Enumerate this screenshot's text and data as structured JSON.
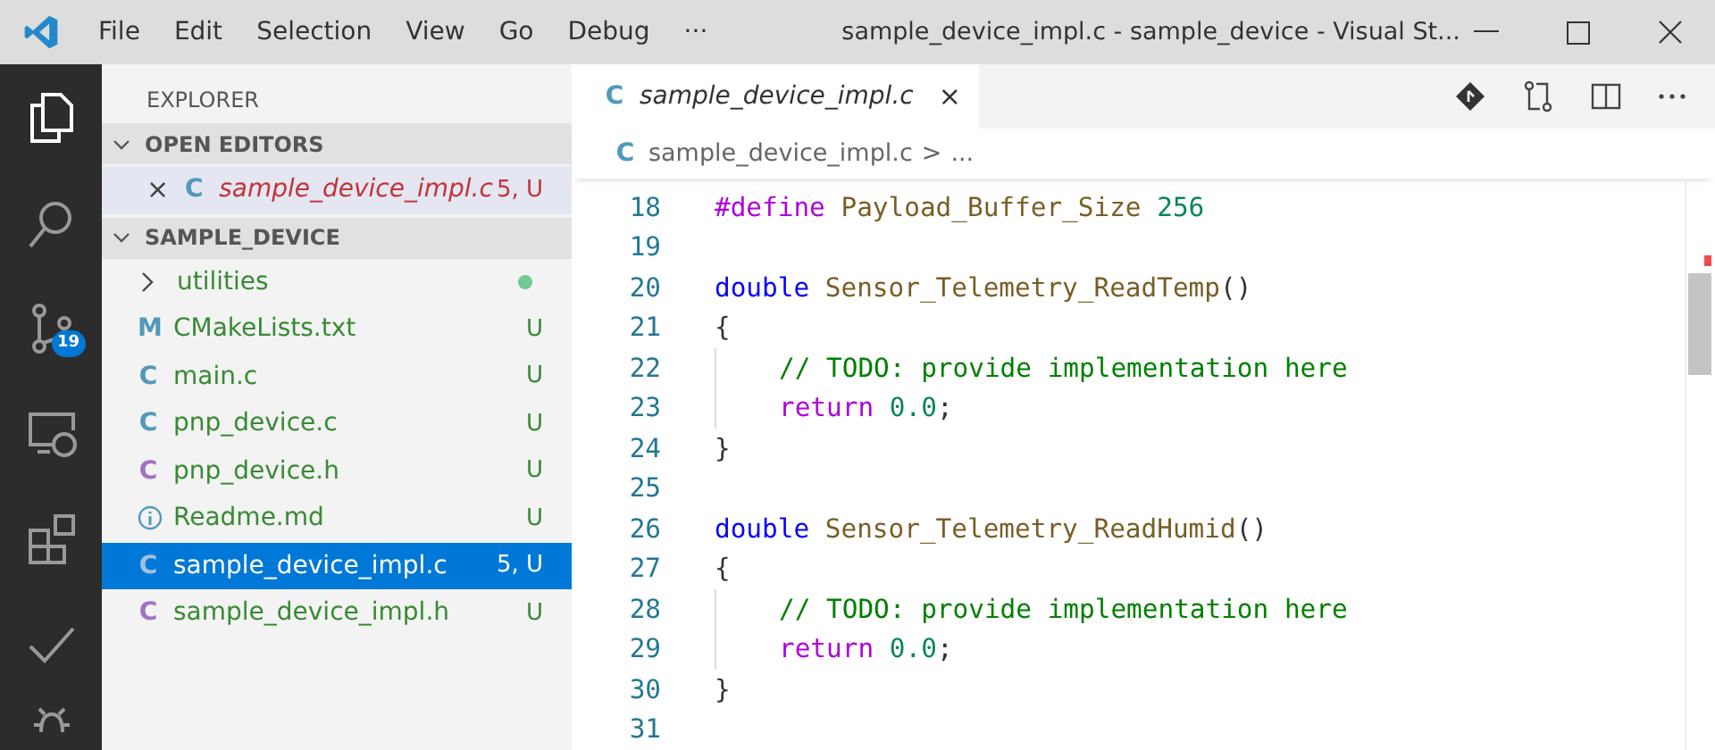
{
  "window": {
    "title": "sample_device_impl.c - sample_device - Visual St..."
  },
  "menu": [
    "File",
    "Edit",
    "Selection",
    "View",
    "Go",
    "Debug",
    "···"
  ],
  "activity_bar": [
    {
      "kind": "files",
      "selected": true
    },
    {
      "kind": "search",
      "selected": false
    },
    {
      "kind": "source-control",
      "selected": false,
      "badge": "19"
    },
    {
      "kind": "remote",
      "selected": false
    },
    {
      "kind": "extensions",
      "selected": false
    },
    {
      "kind": "check",
      "selected": false
    },
    {
      "kind": "debug",
      "selected": false
    }
  ],
  "sidebar": {
    "title": "EXPLORER",
    "open_editors": {
      "title": "OPEN EDITORS",
      "expanded": true,
      "items": [
        {
          "close": "×",
          "icon_text": "C",
          "name": "sample_device_impl.c",
          "decoration": "5, U",
          "has_errors": true,
          "selected": true
        }
      ]
    },
    "folder": {
      "title": "SAMPLE_DEVICE",
      "expanded": true,
      "items": [
        {
          "kind": "folder",
          "name": "utilities",
          "expanded": false,
          "color": "#73c991"
        },
        {
          "kind": "cmake",
          "icon_text": "M",
          "name": "CMakeLists.txt",
          "decoration": "U",
          "has_errors": false,
          "selected": false
        },
        {
          "kind": "source",
          "icon_text": "C",
          "name": "main.c",
          "decoration": "U",
          "has_errors": false,
          "selected": false
        },
        {
          "kind": "source",
          "icon_text": "C",
          "name": "pnp_device.c",
          "decoration": "U",
          "has_errors": false,
          "selected": false
        },
        {
          "kind": "header",
          "icon_text": "C",
          "name": "pnp_device.h",
          "decoration": "U",
          "has_errors": false,
          "selected": false
        },
        {
          "kind": "readme",
          "name": "Readme.md",
          "decoration": "U",
          "has_errors": false,
          "selected": false
        },
        {
          "kind": "source",
          "icon_text": "C",
          "name": "sample_device_impl.c",
          "decoration": "5, U",
          "selected": true
        },
        {
          "kind": "header",
          "icon_text": "C",
          "name": "sample_device_impl.h",
          "decoration": "U",
          "has_errors": false,
          "selected": false
        }
      ]
    }
  },
  "editor": {
    "tabs": [
      {
        "icon_text": "C",
        "label": "sample_device_impl.c",
        "close": "×",
        "selected": true
      }
    ],
    "breadcrumb": {
      "icon_text": "C",
      "file": "sample_device_impl.c",
      "separator": ">",
      "rest": "..."
    },
    "lines": [
      {
        "number": "18",
        "kind": "top",
        "tokens": [
          {
            "kind": "directive",
            "text": "#define"
          },
          {
            "kind": "type",
            "text": " Payload_Buffer_Size "
          },
          {
            "kind": "number",
            "text": "256"
          }
        ]
      },
      {
        "number": "19",
        "kind": "top"
      },
      {
        "number": "20",
        "kind": "top",
        "tokens": [
          {
            "kind": "keyword",
            "text": "double"
          },
          {
            "kind": "function",
            "text": " Sensor_Telemetry_ReadTemp"
          },
          {
            "kind": "plain",
            "text": "()"
          }
        ]
      },
      {
        "number": "21",
        "kind": "top",
        "tokens": [
          {
            "kind": "plain",
            "text": "{"
          }
        ]
      },
      {
        "number": "22",
        "kind": "body",
        "tokens": [
          {
            "kind": "comment",
            "text": "// TODO: provide implementation here"
          }
        ]
      },
      {
        "number": "23",
        "kind": "body",
        "tokens": [
          {
            "kind": "control",
            "text": "return"
          },
          {
            "kind": "number",
            "text": " 0.0"
          },
          {
            "kind": "plain",
            "text": ";"
          }
        ]
      },
      {
        "number": "24",
        "kind": "top",
        "tokens": [
          {
            "kind": "plain",
            "text": "}"
          }
        ]
      },
      {
        "number": "25",
        "kind": "top"
      },
      {
        "number": "26",
        "kind": "top",
        "tokens": [
          {
            "kind": "keyword",
            "text": "double"
          },
          {
            "kind": "function",
            "text": " Sensor_Telemetry_ReadHumid"
          },
          {
            "kind": "plain",
            "text": "()"
          }
        ]
      },
      {
        "number": "27",
        "kind": "top",
        "tokens": [
          {
            "kind": "plain",
            "text": "{"
          }
        ]
      },
      {
        "number": "28",
        "kind": "body",
        "tokens": [
          {
            "kind": "comment",
            "text": "// TODO: provide implementation here"
          }
        ]
      },
      {
        "number": "29",
        "kind": "body",
        "tokens": [
          {
            "kind": "control",
            "text": "return"
          },
          {
            "kind": "number",
            "text": " 0.0"
          },
          {
            "kind": "plain",
            "text": ";"
          }
        ]
      },
      {
        "number": "30",
        "kind": "top",
        "tokens": [
          {
            "kind": "plain",
            "text": "}"
          }
        ]
      },
      {
        "number": "31",
        "kind": "top"
      }
    ]
  }
}
